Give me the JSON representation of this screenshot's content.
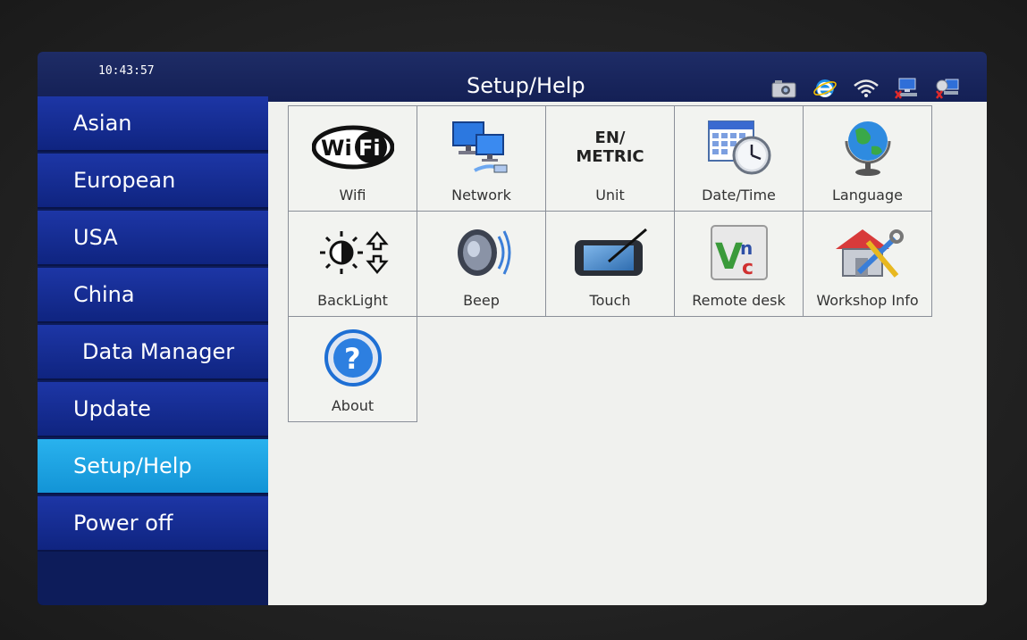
{
  "header": {
    "clock": "10:43:57",
    "title": "Setup/Help",
    "status_icons": [
      "camera-icon",
      "browser-icon",
      "wifi-icon",
      "network-disconnected-icon",
      "remote-disconnected-icon"
    ]
  },
  "sidebar": {
    "items": [
      {
        "label": "Asian"
      },
      {
        "label": "European"
      },
      {
        "label": "USA"
      },
      {
        "label": "China"
      },
      {
        "label": "Data Manager"
      },
      {
        "label": "Update"
      },
      {
        "label": "Setup/Help",
        "active": true
      },
      {
        "label": "Power off"
      }
    ]
  },
  "tiles": [
    {
      "label": "Wifi",
      "icon": "wifi-logo-icon"
    },
    {
      "label": "Network",
      "icon": "network-computers-icon"
    },
    {
      "label": "Unit",
      "icon": "unit-icon",
      "icon_text_1": "EN/",
      "icon_text_2": "METRIC"
    },
    {
      "label": "Date/Time",
      "icon": "calendar-clock-icon"
    },
    {
      "label": "Language",
      "icon": "globe-icon"
    },
    {
      "label": "BackLight",
      "icon": "brightness-icon"
    },
    {
      "label": "Beep",
      "icon": "speaker-icon"
    },
    {
      "label": "Touch",
      "icon": "touch-tablet-icon"
    },
    {
      "label": "Remote desk",
      "icon": "vnc-icon",
      "icon_text": "VNC"
    },
    {
      "label": "Workshop Info",
      "icon": "workshop-tools-icon"
    },
    {
      "label": "About",
      "icon": "help-question-icon",
      "icon_text": "?"
    }
  ],
  "colors": {
    "sidebar_item": "#1a32a0",
    "sidebar_active": "#22a8e8",
    "titlebar": "#172460",
    "content_bg": "#f0f1ee"
  }
}
